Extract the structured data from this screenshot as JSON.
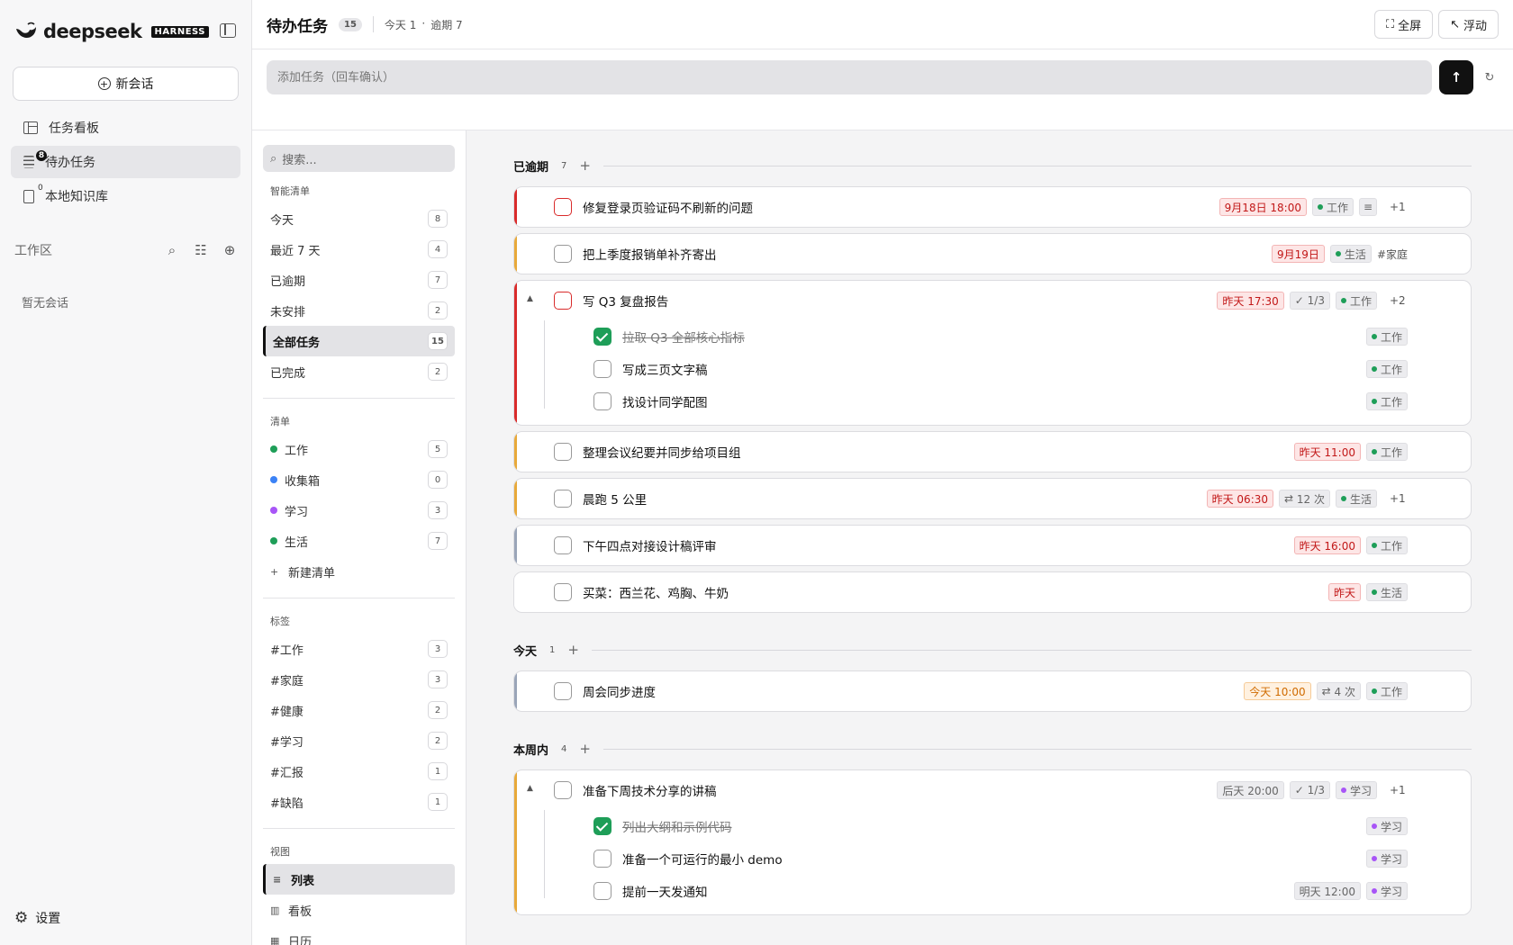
{
  "brand": {
    "name": "deepseek",
    "badge": "HARNESS"
  },
  "sidebar": {
    "new_chat": "新会话",
    "nav": [
      {
        "label": "任务看板"
      },
      {
        "label": "待办任务",
        "badge": "8"
      },
      {
        "label": "本地知识库",
        "badge": "0"
      }
    ],
    "workspace_title": "工作区",
    "empty": "暂无会话",
    "settings": "设置"
  },
  "header": {
    "title": "待办任务",
    "count": "15",
    "today_label": "今天 1",
    "dot": "·",
    "overdue_label": "逾期 7",
    "fullscreen": "全屏",
    "float": "浮动"
  },
  "add_task": {
    "placeholder": "添加任务（回车确认）"
  },
  "filters": {
    "search_placeholder": "搜索...",
    "smart_title": "智能清单",
    "smart": [
      {
        "label": "今天",
        "count": "8"
      },
      {
        "label": "最近 7 天",
        "count": "4"
      },
      {
        "label": "已逾期",
        "count": "7"
      },
      {
        "label": "未安排",
        "count": "2"
      },
      {
        "label": "全部任务",
        "count": "15"
      },
      {
        "label": "已完成",
        "count": "2"
      }
    ],
    "lists_title": "清单",
    "lists": [
      {
        "label": "工作",
        "count": "5",
        "color": "#1e9e58"
      },
      {
        "label": "收集箱",
        "count": "0",
        "color": "#3b82f6"
      },
      {
        "label": "学习",
        "count": "3",
        "color": "#a855f7"
      },
      {
        "label": "生活",
        "count": "7",
        "color": "#1e9e58"
      }
    ],
    "new_list": "新建清单",
    "tags_title": "标签",
    "tags": [
      {
        "label": "#工作",
        "count": "3"
      },
      {
        "label": "#家庭",
        "count": "3"
      },
      {
        "label": "#健康",
        "count": "2"
      },
      {
        "label": "#学习",
        "count": "2"
      },
      {
        "label": "#汇报",
        "count": "1"
      },
      {
        "label": "#缺陷",
        "count": "1"
      }
    ],
    "views_title": "视图",
    "views": [
      {
        "label": "列表"
      },
      {
        "label": "看板"
      },
      {
        "label": "日历"
      }
    ]
  },
  "groups": {
    "overdue": {
      "title": "已逾期",
      "count": "7"
    },
    "today": {
      "title": "今天",
      "count": "1"
    },
    "week": {
      "title": "本周内",
      "count": "4"
    }
  },
  "tasks": {
    "t1": {
      "title": "修复登录页验证码不刷新的问题",
      "date": "9月18日 18:00",
      "list": "工作",
      "more": "+1"
    },
    "t2": {
      "title": "把上季度报销单补齐寄出",
      "date": "9月19日",
      "list": "生活",
      "tag": "#家庭"
    },
    "t3": {
      "title": "写 Q3 复盘报告",
      "date": "昨天 17:30",
      "progress": "1/3",
      "list": "工作",
      "more": "+2",
      "subs": [
        {
          "title": "拉取 Q3 全部核心指标",
          "list": "工作"
        },
        {
          "title": "写成三页文字稿",
          "list": "工作"
        },
        {
          "title": "找设计同学配图",
          "list": "工作"
        }
      ]
    },
    "t4": {
      "title": "整理会议纪要并同步给项目组",
      "date": "昨天 11:00",
      "list": "工作"
    },
    "t5": {
      "title": "晨跑 5 公里",
      "date": "昨天 06:30",
      "repeat": "12 次",
      "list": "生活",
      "more": "+1"
    },
    "t6": {
      "title": "下午四点对接设计稿评审",
      "date": "昨天 16:00",
      "list": "工作"
    },
    "t7": {
      "title": "买菜：西兰花、鸡胸、牛奶",
      "date": "昨天",
      "list": "生活"
    },
    "t8": {
      "title": "周会同步进度",
      "date": "今天 10:00",
      "repeat": "4 次",
      "list": "工作"
    },
    "t9": {
      "title": "准备下周技术分享的讲稿",
      "date": "后天 20:00",
      "progress": "1/3",
      "list": "学习",
      "more": "+1",
      "subs": [
        {
          "title": "列出大纲和示例代码",
          "list": "学习"
        },
        {
          "title": "准备一个可运行的最小 demo",
          "list": "学习"
        },
        {
          "title": "提前一天发通知",
          "date": "明天 12:00",
          "list": "学习"
        }
      ]
    }
  }
}
